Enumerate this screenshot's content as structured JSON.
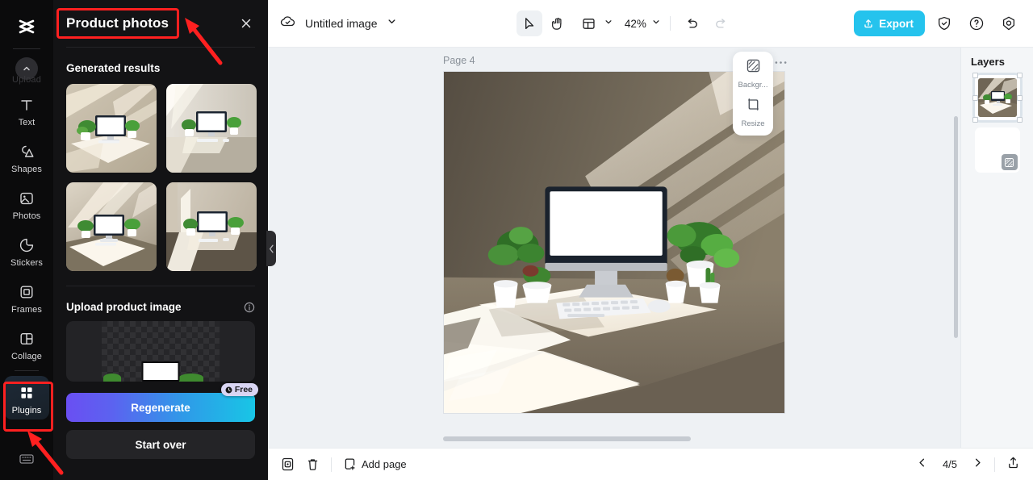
{
  "rail": {
    "logo_icon": "capcut-logo-icon",
    "upload_label": "Upload",
    "items": [
      {
        "label": "Text",
        "icon": "text-icon"
      },
      {
        "label": "Shapes",
        "icon": "shapes-icon"
      },
      {
        "label": "Photos",
        "icon": "photos-icon"
      },
      {
        "label": "Stickers",
        "icon": "stickers-icon"
      },
      {
        "label": "Frames",
        "icon": "frames-icon"
      },
      {
        "label": "Collage",
        "icon": "collage-icon"
      },
      {
        "label": "Plugins",
        "icon": "plugins-icon"
      }
    ],
    "bottom_icon": "keyboard-shortcuts-icon"
  },
  "panel": {
    "title": "Product photos",
    "close_icon": "close-icon",
    "generated_section": "Generated results",
    "results_count": 4,
    "upload_section": "Upload product image",
    "info_icon": "info-icon",
    "regenerate_label": "Regenerate",
    "free_badge": "Free",
    "free_badge_icon": "clock-icon",
    "start_over_label": "Start over",
    "collapse_icon": "chevron-left-icon"
  },
  "topbar": {
    "cloud_icon": "cloud-saved-icon",
    "doc_name": "Untitled image",
    "doc_chevron_icon": "chevron-down-icon",
    "select_tool_icon": "cursor-select-icon",
    "hand_tool_icon": "hand-pan-icon",
    "layout_tool_icon": "page-layout-icon",
    "layout_chevron_icon": "chevron-down-icon",
    "zoom_value": "42%",
    "zoom_chevron_icon": "chevron-down-icon",
    "undo_icon": "undo-icon",
    "redo_icon": "redo-icon",
    "export_label": "Export",
    "export_icon": "export-upload-icon",
    "export_color": "#25c3ed",
    "shield_icon": "shield-check-icon",
    "help_icon": "help-circle-icon",
    "settings_icon": "settings-gear-icon"
  },
  "canvas": {
    "page_label": "Page 4",
    "duplicate_page_icon": "duplicate-page-icon",
    "more_icon": "more-horizontal-icon",
    "float_tools": [
      {
        "label": "Backgr...",
        "icon": "background-icon"
      },
      {
        "label": "Resize",
        "icon": "resize-icon"
      }
    ]
  },
  "layers": {
    "title": "Layers",
    "items": [
      {
        "name": "image-layer",
        "selected": true
      },
      {
        "name": "background-layer",
        "selected": false,
        "badge_icon": "background-icon"
      }
    ]
  },
  "bottombar": {
    "duplicate_icon": "duplicate-icon",
    "delete_icon": "trash-icon",
    "add_page_label": "Add page",
    "add_page_icon": "add-page-icon",
    "prev_icon": "chevron-left-icon",
    "page_indicator": "4/5",
    "next_icon": "chevron-right-icon",
    "upload_icon": "upload-icon"
  },
  "annotations": {
    "box1_target": "panel-title",
    "box2_target": "sidebar-item-plugins",
    "color": "#ff2020"
  }
}
